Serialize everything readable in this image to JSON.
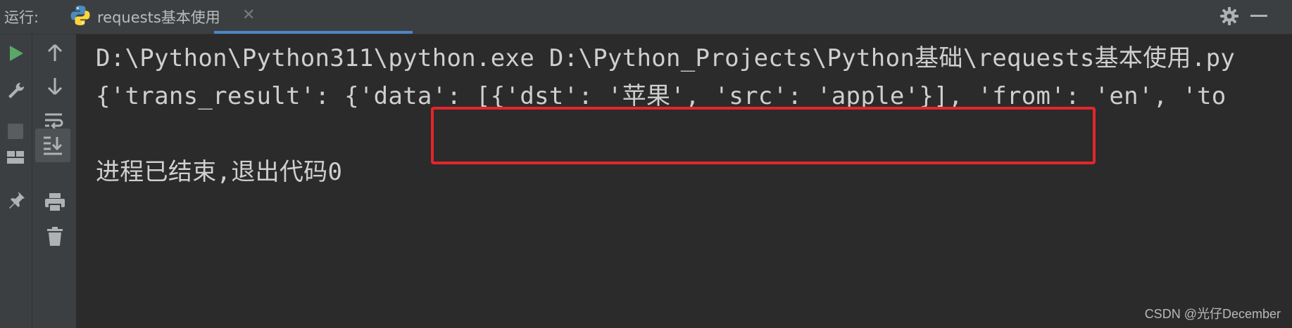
{
  "header": {
    "run_label": "运行:",
    "tab_label": "requests基本使用",
    "tab_close": "✕"
  },
  "console": {
    "line1": "D:\\Python\\Python311\\python.exe D:\\Python_Projects\\Python基础\\requests基本使用.py",
    "line2": "{'trans_result': {'data': [{'dst': '苹果', 'src': 'apple'}], 'from': 'en', 'to",
    "line3": "进程已结束,退出代码0"
  },
  "watermark": "CSDN @光仔December",
  "colors": {
    "highlight_border": "#e3262a",
    "run_green": "#59a869",
    "tab_accent": "#4a88c7"
  },
  "icons": {
    "left_toolbar": [
      "run-icon",
      "wrench-icon",
      "stop-icon",
      "layout-icon",
      "pin-icon"
    ],
    "second_toolbar": [
      "arrow-up-icon",
      "arrow-down-icon",
      "soft-wrap-icon",
      "scroll-to-end-icon",
      "print-icon",
      "trash-icon"
    ]
  }
}
